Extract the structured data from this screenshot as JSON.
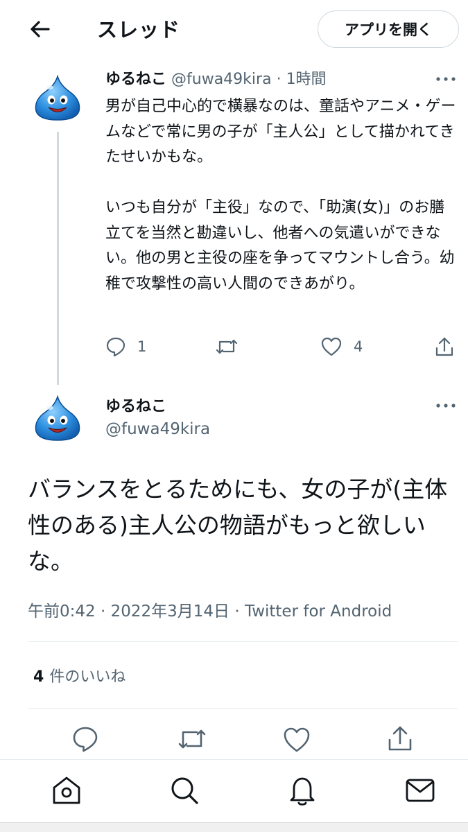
{
  "header": {
    "title": "スレッド",
    "open_app_label": "アプリを開く",
    "back_icon": "arrow-left-icon"
  },
  "tweet1": {
    "name": "ゆるねこ",
    "handle": "@fuwa49kira",
    "separator": "·",
    "time": "1時間",
    "text": "男が自己中心的で横暴なのは、童話やアニメ・ゲームなどで常に男の子が「主人公」として描かれてきたせいかもな。\n\nいつも自分が「主役」なので、「助演(女)」のお膳立てを当然と勘違いし、他者への気遣いができない。他の男と主役の座を争ってマウントし合う。幼稚で攻撃性の高い人間のできあがり。",
    "reply_count": "1",
    "like_count": "4"
  },
  "tweet2": {
    "name": "ゆるねこ",
    "handle": "@fuwa49kira",
    "text": "バランスをとるためにも、女の子が(主体性のある)主人公の物語がもっと欲しいな。",
    "meta": "午前0:42 · 2022年3月14日 · Twitter for Android"
  },
  "likes_summary": {
    "count": "4",
    "label": "件のいいね"
  },
  "colors": {
    "text": "#0f1419",
    "secondary": "#536471",
    "divider": "#e6ecf0",
    "slime_blue": "#2d8fe0"
  },
  "icons": [
    "arrow-left-icon",
    "more-dots-icon",
    "reply-icon",
    "retweet-icon",
    "like-icon",
    "share-icon",
    "home-icon",
    "search-icon",
    "notifications-icon",
    "messages-icon",
    "slime-avatar-icon"
  ]
}
